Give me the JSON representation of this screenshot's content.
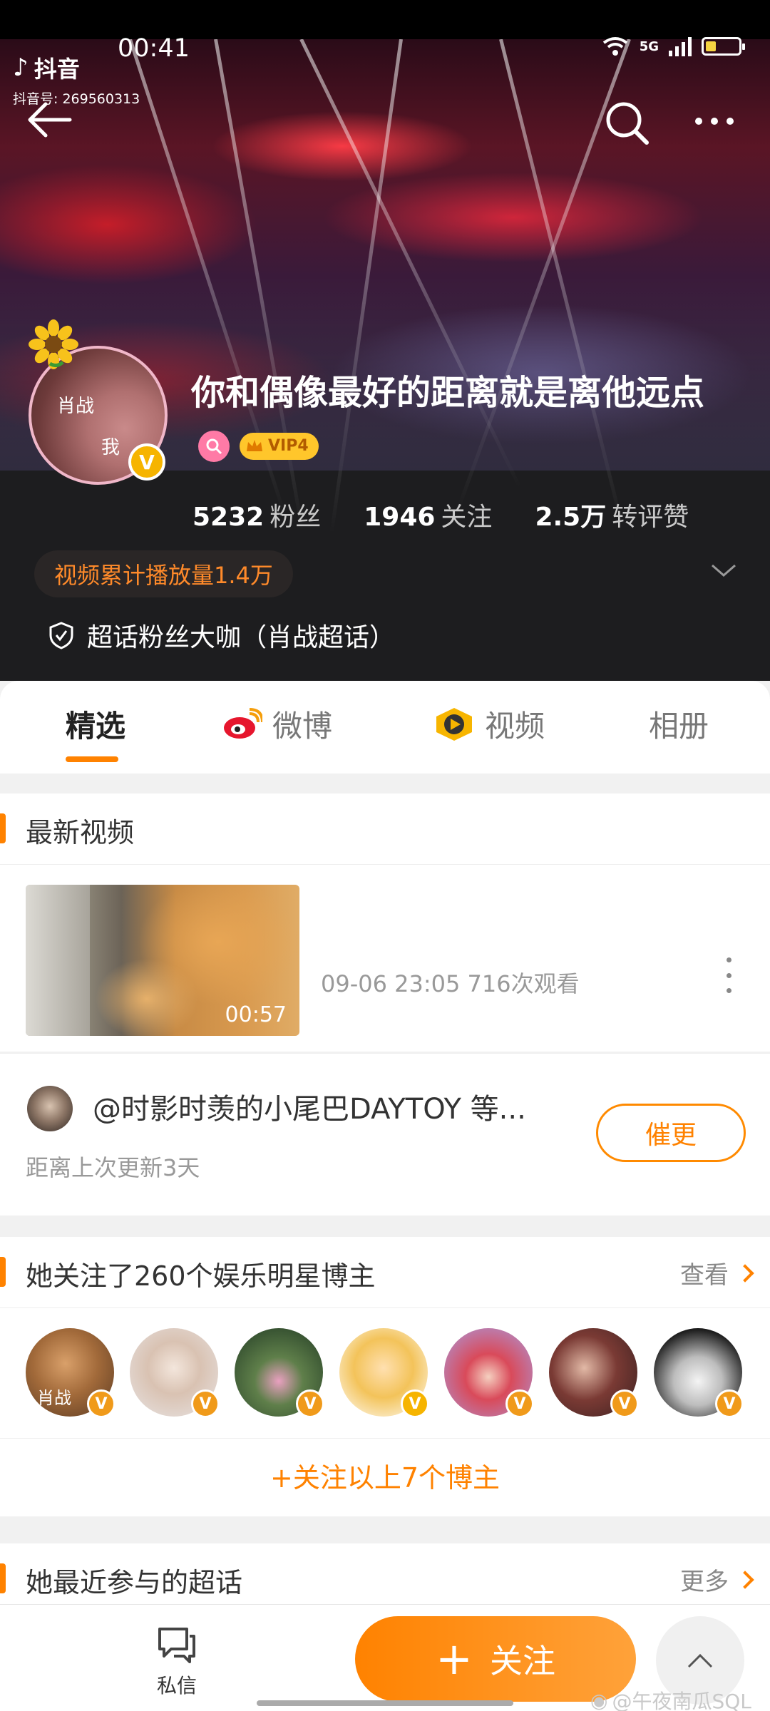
{
  "status_bar": {
    "time": "00:41",
    "network": "5G"
  },
  "douyin_watermark": {
    "app_name": "抖音",
    "id_text": "抖音号: 269560313"
  },
  "profile": {
    "avatar_text_line1": "肖战",
    "avatar_text_line2": "我",
    "verified_badge": "V",
    "username": "你和偶像最好的距离就是离他远点",
    "vip_label": "VIP4",
    "stats": [
      {
        "value": "5232",
        "label": "粉丝"
      },
      {
        "value": "1946",
        "label": "关注"
      },
      {
        "value": "2.5万",
        "label": "转评赞"
      }
    ],
    "play_count": "视频累计播放量1.4万",
    "supertopic_title": "超话粉丝大咖（肖战超话）"
  },
  "tabs": [
    {
      "label": "精选",
      "icon": null,
      "active": true
    },
    {
      "label": "微博",
      "icon": "weibo-icon",
      "active": false
    },
    {
      "label": "视频",
      "icon": "video-icon",
      "active": false
    },
    {
      "label": "相册",
      "icon": null,
      "active": false
    }
  ],
  "latest_videos": {
    "title": "最新视频",
    "video": {
      "duration": "00:57",
      "meta": "09-06 23:05 716次观看"
    }
  },
  "update_reminder": {
    "text": "@时影时羡的小尾巴DAYTOY 等...",
    "subtext": "距离上次更新3天",
    "button": "催更"
  },
  "following_stars": {
    "title": "她关注了260个娱乐明星博主",
    "more": "查看",
    "first_avatar_text": "肖战",
    "follow_all": "+关注以上7个博主"
  },
  "supertopics": {
    "title": "她最近参与的超话",
    "more": "更多"
  },
  "bottom_bar": {
    "dm_label": "私信",
    "follow_label": "关注",
    "watermark": "@午夜南瓜SQL"
  },
  "colors": {
    "accent": "#ff8200",
    "vip": "#ffc62b",
    "header_bg": "#1d1d1f"
  }
}
